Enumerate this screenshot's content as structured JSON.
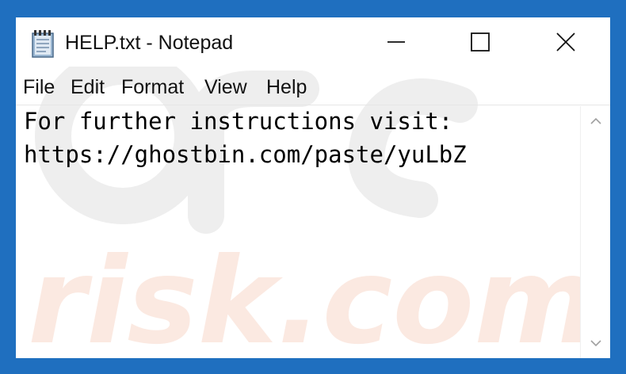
{
  "window": {
    "title": "HELP.txt - Notepad"
  },
  "menu": {
    "items": [
      "File",
      "Edit",
      "Format",
      "View",
      "Help"
    ]
  },
  "editor": {
    "lines": [
      "For further instructions visit:",
      "https://ghostbin.com/paste/yuLbZ"
    ]
  },
  "icons": {
    "app": "notepad-icon",
    "minimize": "minimize-icon",
    "maximize": "maximize-icon",
    "close": "close-icon",
    "scroll_up": "chevron-up-icon",
    "scroll_down": "chevron-down-icon"
  },
  "colors": {
    "frame": "#1f6fbf",
    "background": "#ffffff",
    "text": "#000000"
  }
}
